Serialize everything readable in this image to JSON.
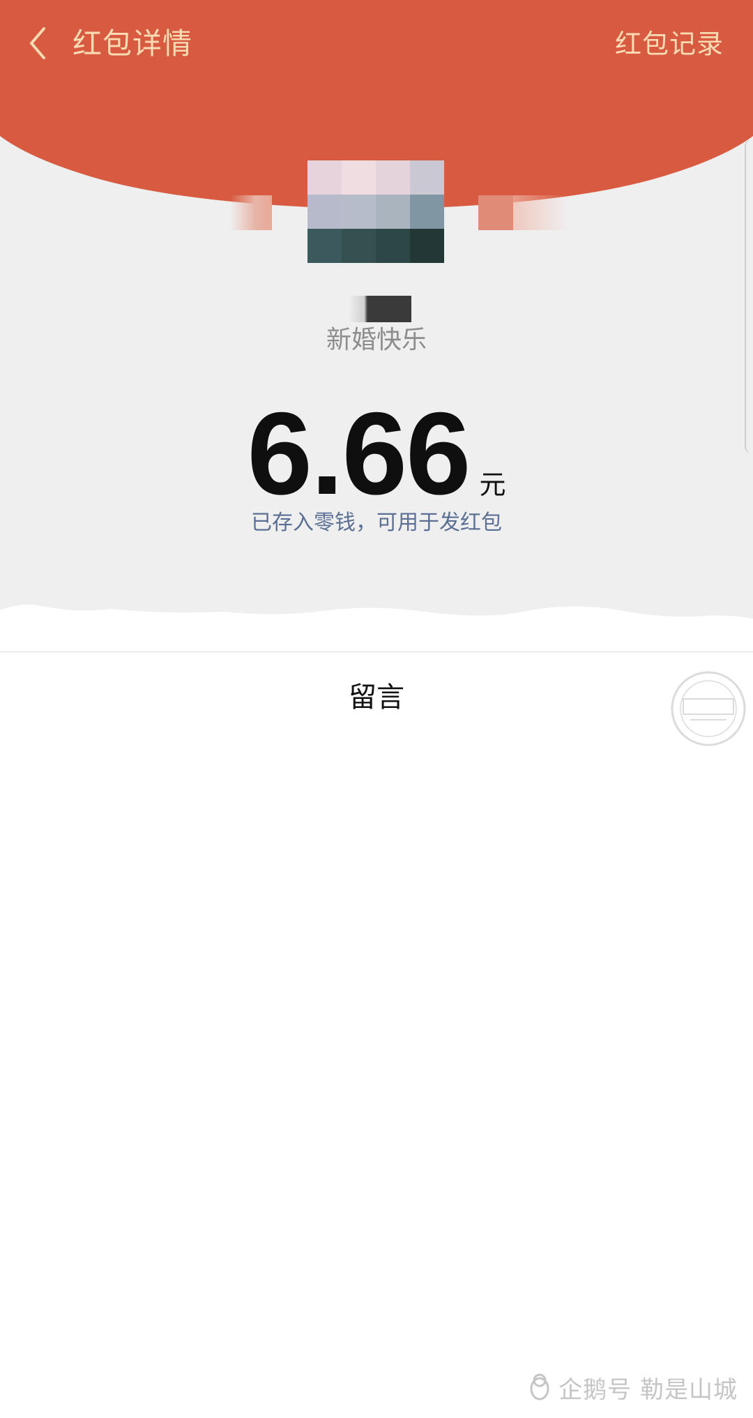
{
  "header": {
    "title": "红包详情",
    "records_link": "红包记录",
    "back_icon": "chevron-left-icon",
    "background_color": "#d85a40",
    "text_color": "#f9dcb4"
  },
  "envelope": {
    "greeting": "新婚快乐",
    "amount": "6.66",
    "currency": "元",
    "saved_note": "已存入零钱，可用于发红包"
  },
  "message": {
    "label": "留言"
  },
  "watermark": {
    "stamp_icon": "site-stamp-icon",
    "stamp_text": "",
    "footer_icon": "penguin-icon",
    "footer_text": "企鹅号 勒是山城"
  }
}
